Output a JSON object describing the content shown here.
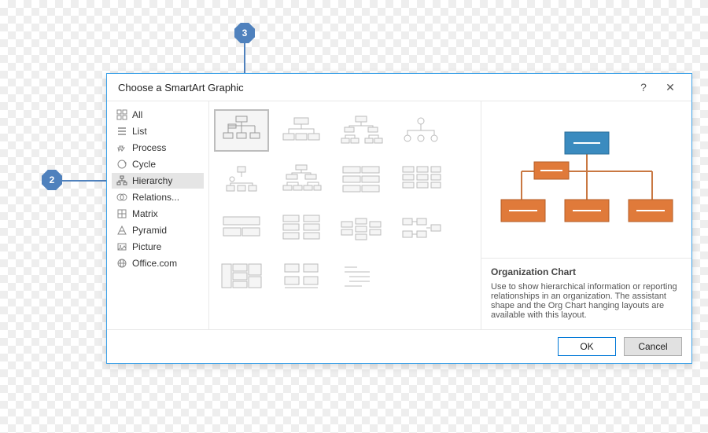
{
  "dialog": {
    "title": "Choose a SmartArt Graphic",
    "help": "?",
    "close": "✕"
  },
  "sidebar": {
    "items": [
      {
        "label": "All"
      },
      {
        "label": "List"
      },
      {
        "label": "Process"
      },
      {
        "label": "Cycle"
      },
      {
        "label": "Hierarchy"
      },
      {
        "label": "Relations..."
      },
      {
        "label": "Matrix"
      },
      {
        "label": "Pyramid"
      },
      {
        "label": "Picture"
      },
      {
        "label": "Office.com"
      }
    ]
  },
  "preview": {
    "name": "Organization Chart",
    "description": "Use to show hierarchical information or reporting relationships in an organization. The assistant shape and the Org Chart hanging layouts are available with this layout."
  },
  "footer": {
    "ok": "OK",
    "cancel": "Cancel"
  },
  "callouts": {
    "c2": "2",
    "c3": "3"
  },
  "palette": {
    "accent": "#0078d7",
    "preview_blue": "#3b8bbf",
    "preview_orange": "#e07a3a"
  }
}
